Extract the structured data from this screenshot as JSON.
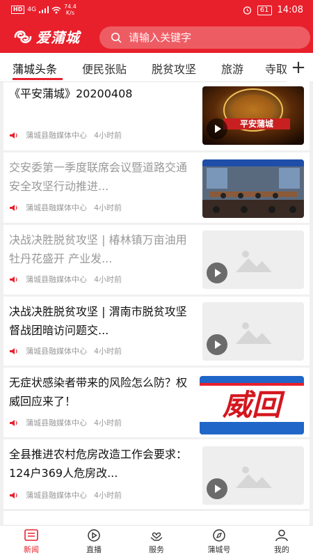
{
  "status_bar": {
    "network": "HD",
    "signal": "4G",
    "speed_value": "74.4",
    "speed_unit": "K/s",
    "battery": "61",
    "time": "14:08"
  },
  "header": {
    "app_name": "爱蒲城",
    "search_placeholder": "请输入关键字"
  },
  "tabs": [
    "蒲城头条",
    "便民张贴",
    "脱贫攻坚",
    "旅游",
    "寺取"
  ],
  "tabs_add_label": "+",
  "news": [
    {
      "title": "《平安蒲城》20200408",
      "source": "蒲城县融媒体中心",
      "time": "4小时前",
      "read": false,
      "thumb": "pinan"
    },
    {
      "title": "交安委第一季度联席会议暨道路交通安全攻坚行动推进...",
      "source": "蒲城县融媒体中心",
      "time": "4小时前",
      "read": true,
      "thumb": "meeting"
    },
    {
      "title": "决战决胜脱贫攻坚 | 椿林镇万亩油用牡丹花盛开 产业发...",
      "source": "蒲城县融媒体中心",
      "time": "4小时前",
      "read": true,
      "thumb": "placeholder"
    },
    {
      "title": "决战决胜脱贫攻坚 | 渭南市脱贫攻坚督战团暗访问题交...",
      "source": "蒲城县融媒体中心",
      "time": "4小时前",
      "read": false,
      "thumb": "placeholder"
    },
    {
      "title": "无症状感染者带来的风险怎么防？权威回应来了！",
      "source": "蒲城县融媒体中心",
      "time": "4小时前",
      "read": false,
      "thumb": "weihui"
    },
    {
      "title": "全县推进农村危房改造工作会要求：124户369人危房改...",
      "source": "蒲城县融媒体中心",
      "time": "4小时前",
      "read": false,
      "thumb": "placeholder"
    }
  ],
  "thumb_text": {
    "pinan": "平安蒲城",
    "weihui": "威回"
  },
  "bottom_nav": [
    {
      "label": "新闻",
      "icon": "news-icon",
      "active": true
    },
    {
      "label": "直播",
      "icon": "play-circle-icon",
      "active": false
    },
    {
      "label": "服务",
      "icon": "heart-hands-icon",
      "active": false
    },
    {
      "label": "蒲城号",
      "icon": "compass-icon",
      "active": false
    },
    {
      "label": "我的",
      "icon": "person-icon",
      "active": false
    }
  ],
  "colors": {
    "brand": "#e8202c",
    "read_text": "#999999",
    "text": "#111111"
  }
}
